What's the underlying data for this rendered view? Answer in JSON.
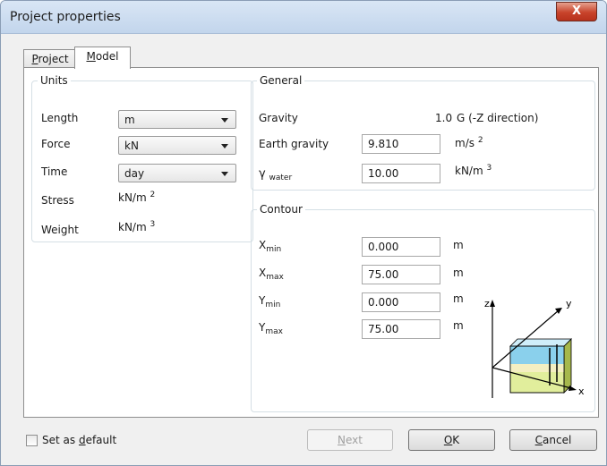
{
  "window": {
    "title": "Project properties",
    "close_label": "X"
  },
  "tabs": [
    {
      "label": "Project",
      "mnemonic": "P",
      "rest": "roject",
      "active": false
    },
    {
      "label": "Model",
      "mnemonic": "M",
      "rest": "odel",
      "active": true
    }
  ],
  "units": {
    "legend": "Units",
    "length": {
      "label": "Length",
      "value": "m"
    },
    "force": {
      "label": "Force",
      "value": "kN"
    },
    "time": {
      "label": "Time",
      "value": "day"
    },
    "stress": {
      "label": "Stress",
      "unit_base": "kN/m",
      "unit_exp": "2"
    },
    "weight": {
      "label": "Weight",
      "unit_base": "kN/m",
      "unit_exp": "3"
    }
  },
  "general": {
    "legend": "General",
    "gravity": {
      "label": "Gravity",
      "value": "1.0",
      "unit": "G (-Z direction)"
    },
    "earth_gravity": {
      "label": "Earth gravity",
      "value": "9.810",
      "unit_base": "m/s",
      "unit_exp": "2"
    },
    "gamma_water": {
      "symbol": "γ",
      "sub": "water",
      "value": "10.00",
      "unit_base": "kN/m",
      "unit_exp": "3"
    }
  },
  "contour": {
    "legend": "Contour",
    "fields": [
      {
        "sym": "X",
        "sub": "min",
        "value": "0.000",
        "unit": "m"
      },
      {
        "sym": "X",
        "sub": "max",
        "value": "75.00",
        "unit": "m"
      },
      {
        "sym": "Y",
        "sub": "min",
        "value": "0.000",
        "unit": "m"
      },
      {
        "sym": "Y",
        "sub": "max",
        "value": "75.00",
        "unit": "m"
      }
    ],
    "axes": {
      "z": "z",
      "y": "y",
      "x": "x"
    }
  },
  "footer": {
    "default_label_pre": "Set as ",
    "default_mnemonic": "d",
    "default_label_post": "efault",
    "default_checked": false,
    "next": {
      "mnemonic": "N",
      "rest": "ext"
    },
    "ok": {
      "mnemonic": "O",
      "rest": "K"
    },
    "cancel": {
      "mnemonic": "C",
      "rest": "ancel"
    }
  }
}
